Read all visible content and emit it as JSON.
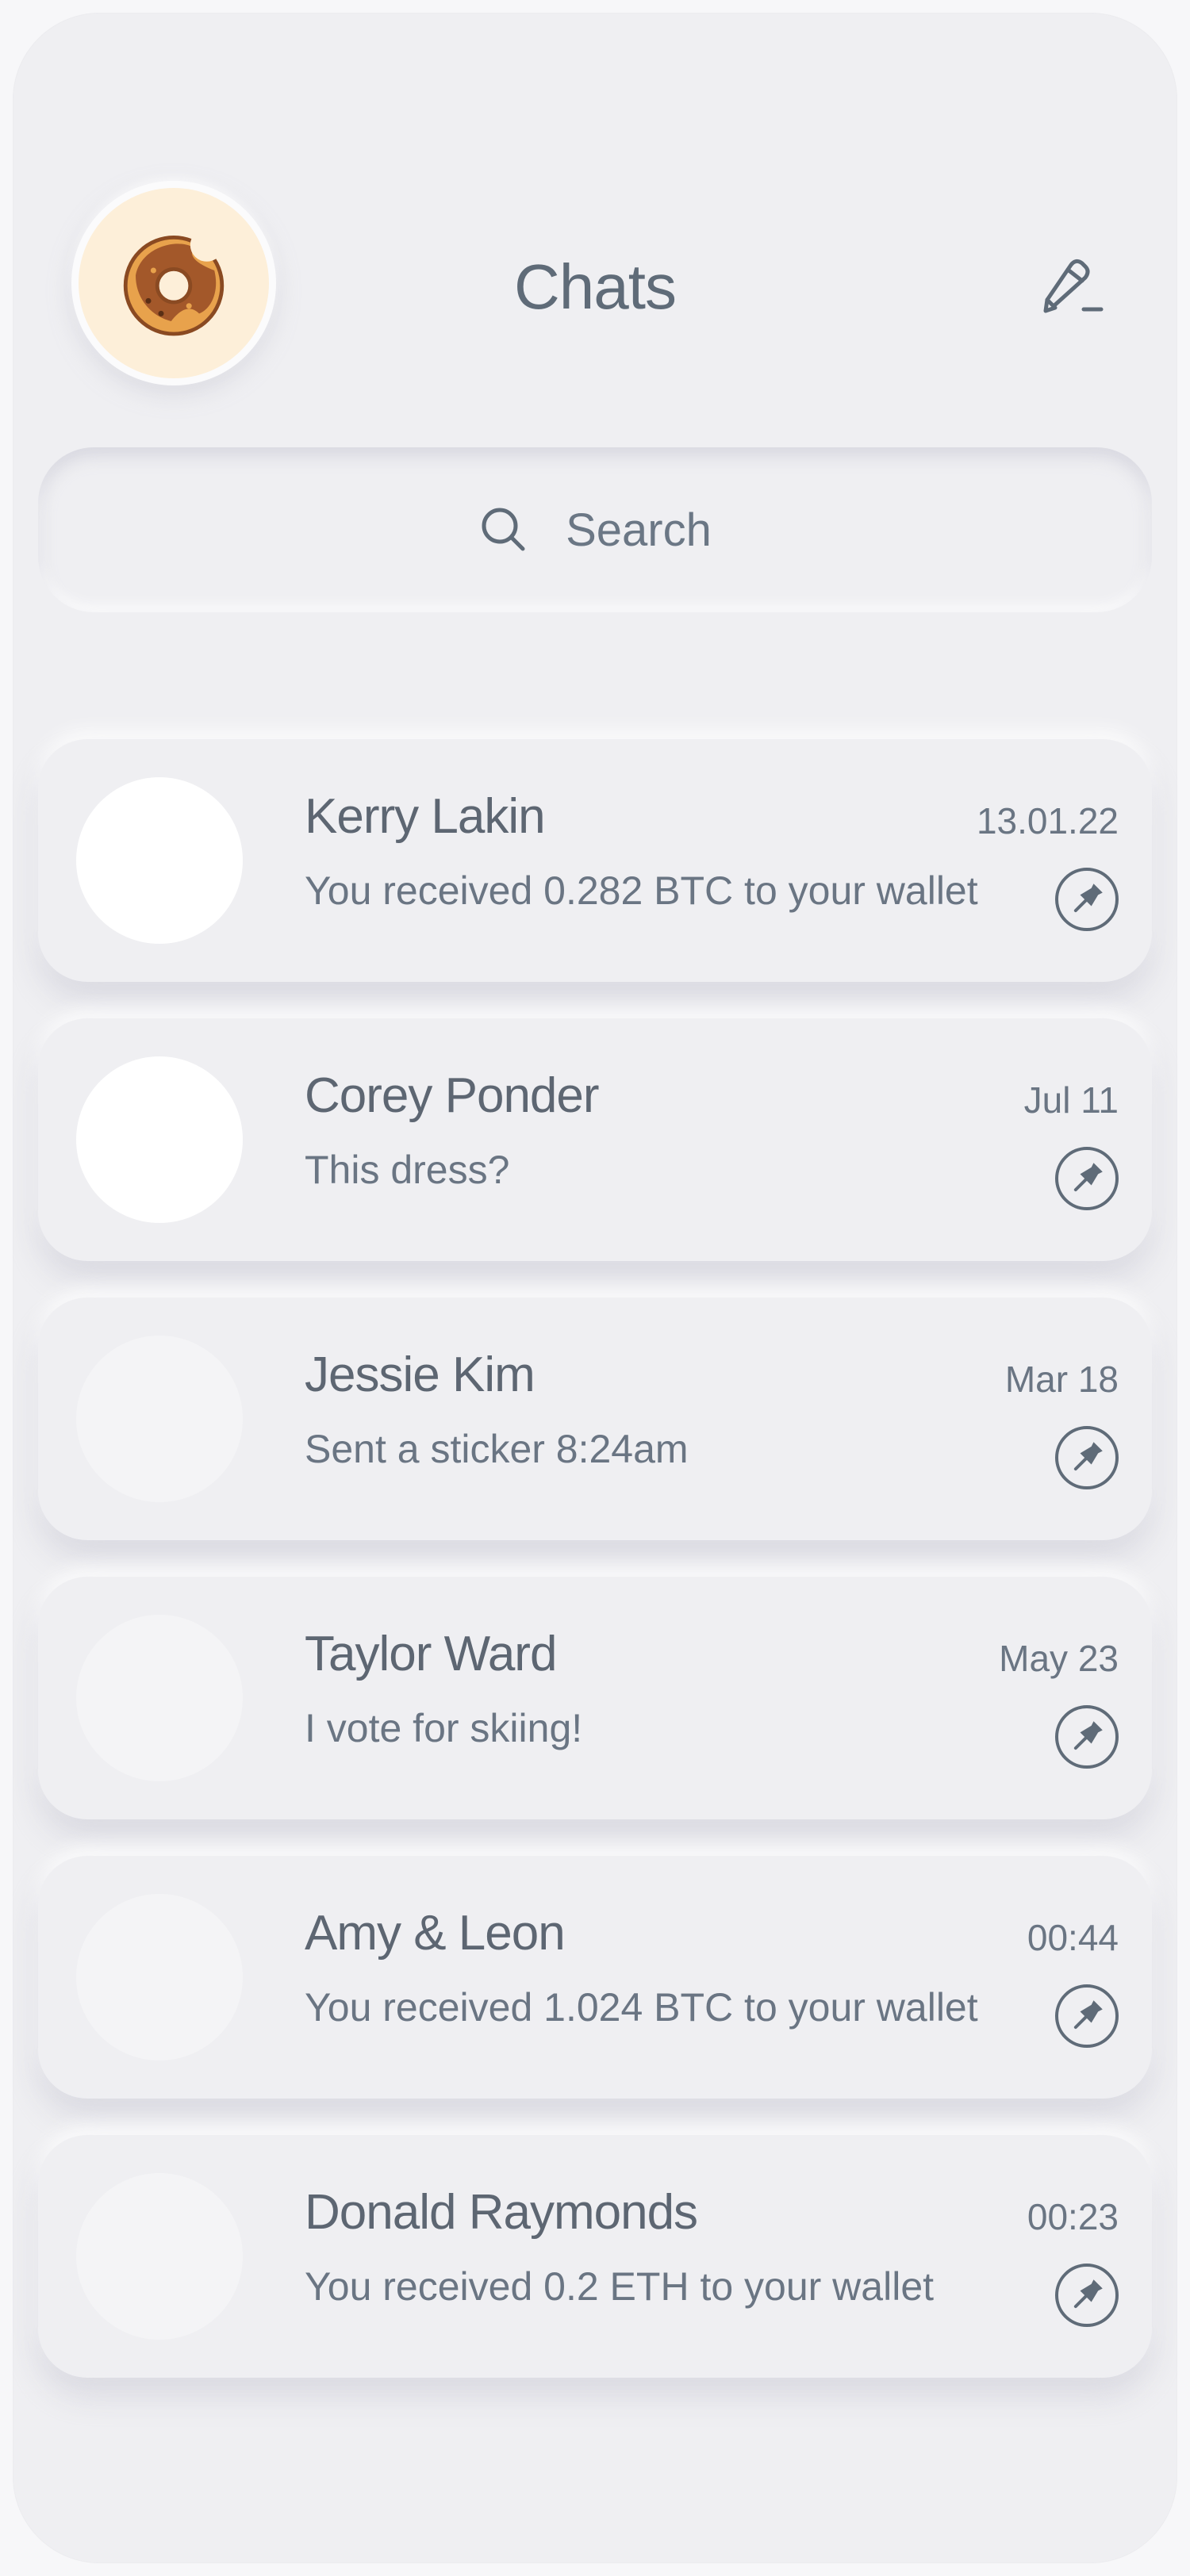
{
  "header": {
    "title": "Chats",
    "avatar_icon": "donut-icon",
    "compose_icon": "pencil-icon"
  },
  "search": {
    "placeholder": "Search",
    "icon": "search-icon"
  },
  "chats": [
    {
      "name": "Kerry Lakin",
      "preview": "You received 0.282 BTC to your wallet",
      "time": "13.01.22",
      "avatar_color": "#ffffff",
      "pinned_icon": "pin-icon"
    },
    {
      "name": "Corey Ponder",
      "preview": "This dress?",
      "time": "Jul 11",
      "avatar_color": "#ffffff",
      "pinned_icon": "pin-icon"
    },
    {
      "name": "Jessie Kim",
      "preview": "Sent a sticker 8:24am",
      "time": "Mar 18",
      "avatar_color": "#f4f4f6",
      "pinned_icon": "pin-icon"
    },
    {
      "name": "Taylor Ward",
      "preview": "I vote for skiing!",
      "time": "May 23",
      "avatar_color": "#f4f4f6",
      "pinned_icon": "pin-icon"
    },
    {
      "name": "Amy & Leon",
      "preview": "You received 1.024 BTC to your wallet",
      "time": "00:44",
      "avatar_color": "#f4f4f6",
      "pinned_icon": "pin-icon"
    },
    {
      "name": "Donald Raymonds",
      "preview": "You received 0.2 ETH to your wallet",
      "time": "00:23",
      "avatar_color": "#f4f4f6",
      "pinned_icon": "pin-icon"
    }
  ],
  "colors": {
    "background": "#efeff2",
    "text_primary": "#5d6672",
    "text_secondary": "#6a7583",
    "icon": "#5f6b78",
    "avatar_bg": "#fdefd9"
  }
}
